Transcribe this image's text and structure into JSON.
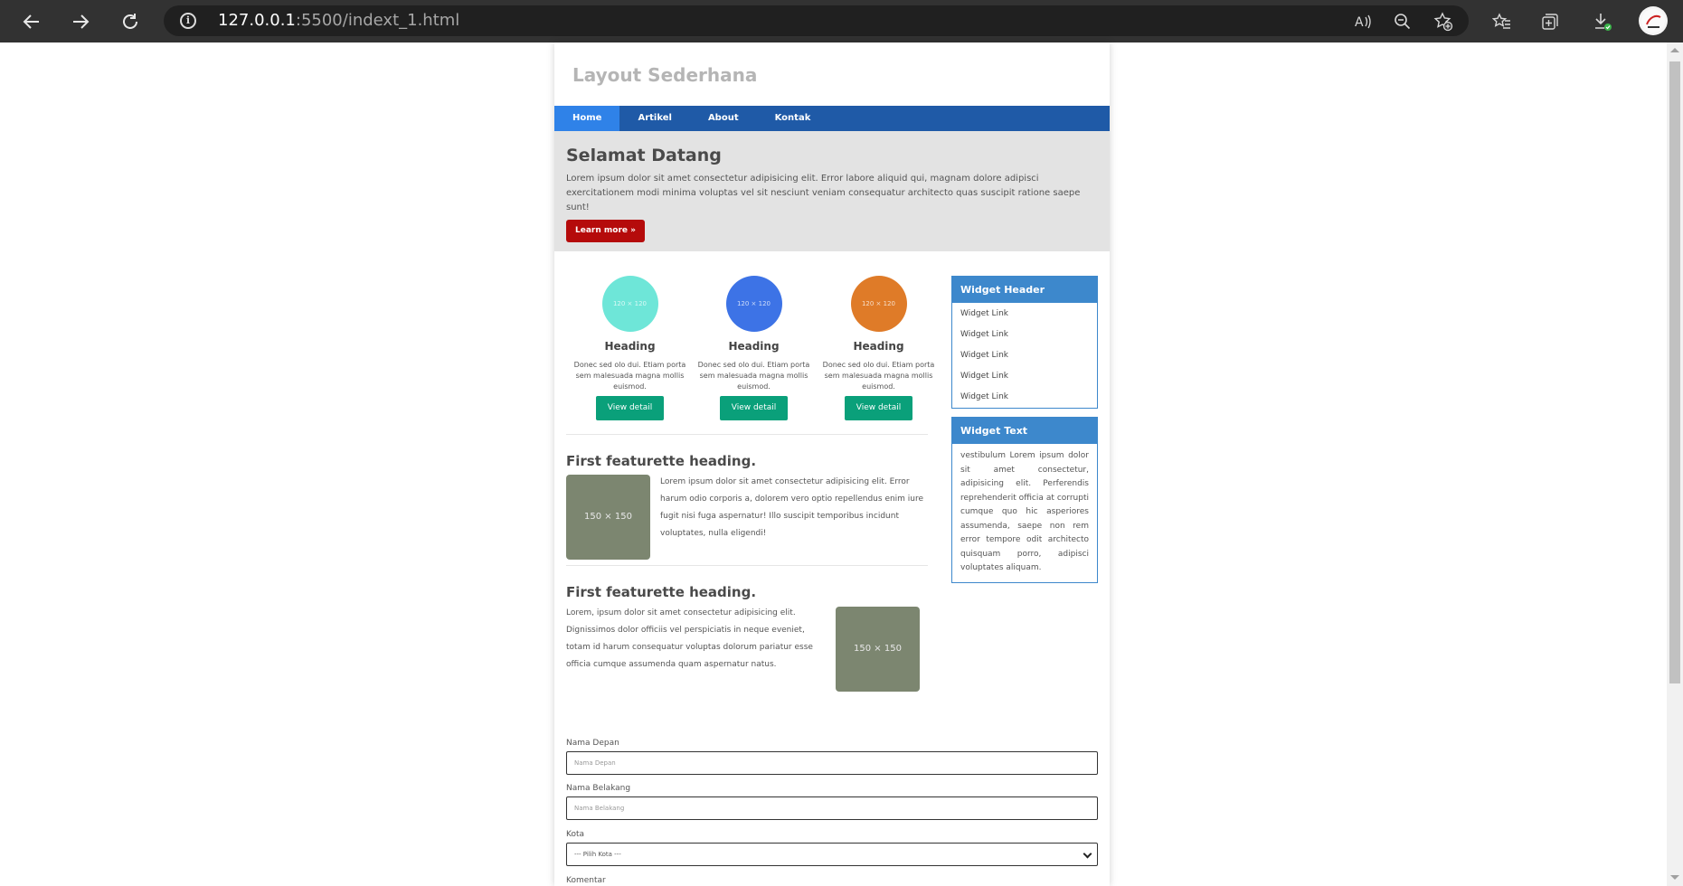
{
  "browser": {
    "url_host": "127.0.0.1",
    "url_rest": ":5500/indext_1.html"
  },
  "site": {
    "title": "Layout Sederhana",
    "menu": [
      "Home",
      "Artikel",
      "About",
      "Kontak"
    ]
  },
  "hero": {
    "heading": "Selamat Datang",
    "text": "Lorem ipsum dolor sit amet consectetur adipisicing elit. Error labore aliquid qui, magnam dolore adipisci exercitationem modi minima voluptas vel sit nesciunt veniam consequatur architecto quas suscipit ratione saepe sunt!",
    "button": "Learn more »"
  },
  "columns": [
    {
      "placeholder": "120 × 120",
      "color": "#6ee6d8",
      "heading": "Heading",
      "text": "Donec sed olo dui. Etiam porta sem malesuada magna mollis euismod.",
      "button": "View detail"
    },
    {
      "placeholder": "120 × 120",
      "color": "#3d73e6",
      "heading": "Heading",
      "text": "Donec sed olo dui. Etiam porta sem malesuada magna mollis euismod.",
      "button": "View detail"
    },
    {
      "placeholder": "120 × 120",
      "color": "#df7b28",
      "heading": "Heading",
      "text": "Donec sed olo dui. Etiam porta sem malesuada magna mollis euismod.",
      "button": "View detail"
    }
  ],
  "featurettes": [
    {
      "heading": "First featurette heading.",
      "image": "150 × 150",
      "text": "Lorem ipsum dolor sit amet consectetur adipisicing elit. Error harum odio corporis a, dolorem vero optio repellendus enim iure fugit nisi fuga aspernatur! Illo suscipit temporibus incidunt voluptates, nulla eligendi!"
    },
    {
      "heading": "First featurette heading.",
      "image": "150 × 150",
      "text": "Lorem, ipsum dolor sit amet consectetur adipisicing elit. Dignissimos dolor officiis vel perspiciatis in neque eveniet, totam id harum consequatur voluptas dolorum pariatur esse officia cumque assumenda quam aspernatur natus."
    }
  ],
  "widget_links": {
    "header": "Widget Header",
    "links": [
      "Widget Link",
      "Widget Link",
      "Widget Link",
      "Widget Link",
      "Widget Link"
    ]
  },
  "widget_text": {
    "header": "Widget Text",
    "text": "vestibulum Lorem ipsum dolor sit amet consectetur, adipisicing elit. Perferendis reprehenderit officia at corrupti cumque quo hic asperiores assumenda, saepe non rem error tempore odit architecto quisquam porro, adipisci voluptates aliquam."
  },
  "form": {
    "first_name_label": "Nama Depan",
    "first_name_placeholder": "Nama Depan",
    "last_name_label": "Nama Belakang",
    "last_name_placeholder": "Nama Belakang",
    "city_label": "Kota",
    "city_selected": "--- Pilih Kota ---",
    "comment_label": "Komentar"
  }
}
